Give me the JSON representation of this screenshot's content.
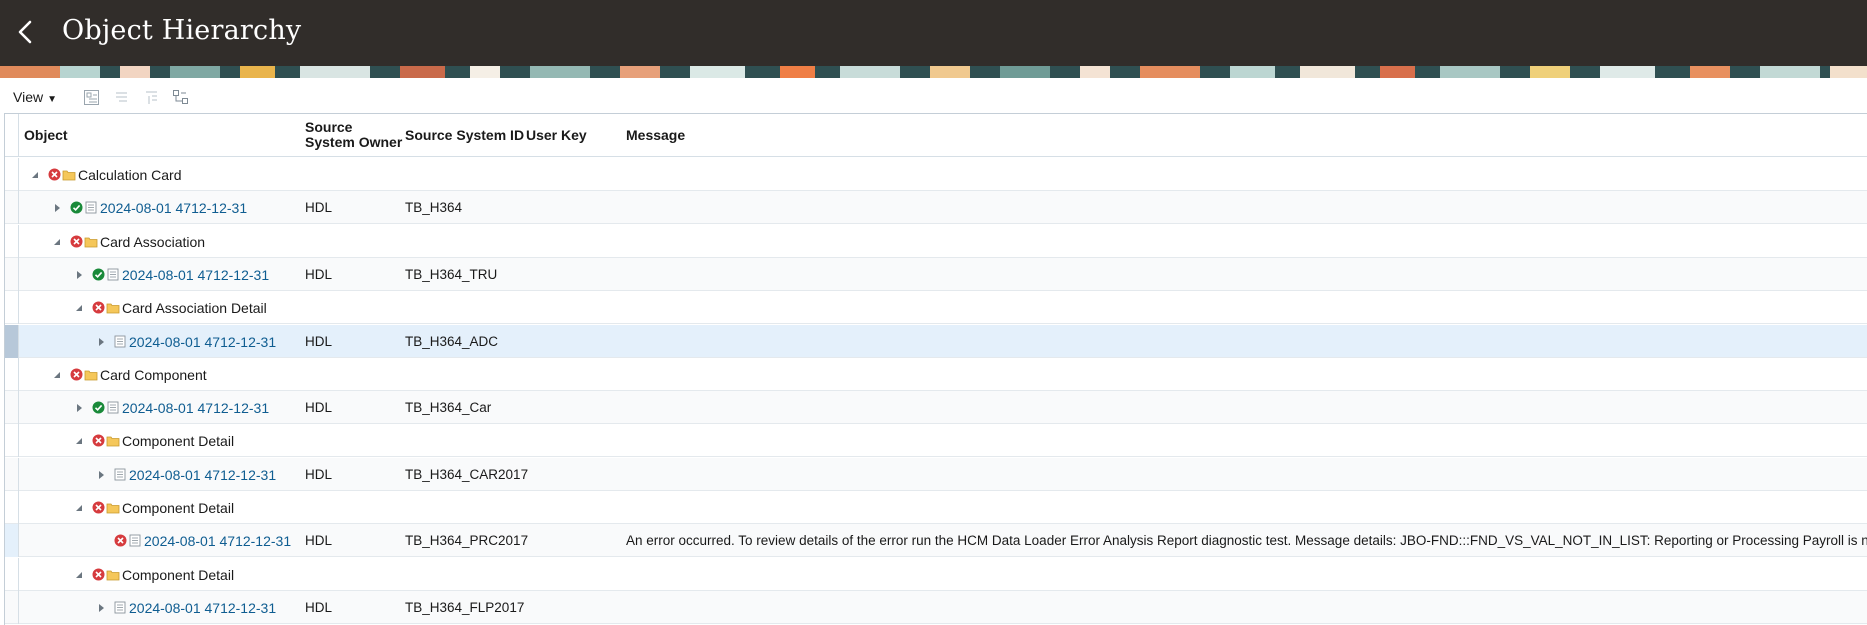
{
  "header": {
    "title": "Object Hierarchy"
  },
  "toolbar": {
    "view_label": "View",
    "tools": [
      "expand-all-icon",
      "collapse-icon",
      "collapse-all-icon",
      "hierarchy-icon"
    ]
  },
  "table": {
    "columns": {
      "object": "Object",
      "owner_line1": "Source",
      "owner_line2": "System Owner",
      "ssid": "Source System ID",
      "user_key": "User Key",
      "message": "Message"
    },
    "rows": [
      {
        "level": 0,
        "expanded": true,
        "type": "folder",
        "status": "error",
        "label": "Calculation Card",
        "owner": "",
        "ssid": "",
        "user_key": "",
        "message": ""
      },
      {
        "level": 1,
        "expanded": false,
        "type": "record",
        "status": "success",
        "label": "2024-08-01 4712-12-31",
        "owner": "HDL",
        "ssid": "TB_H364",
        "user_key": "",
        "message": ""
      },
      {
        "level": 1,
        "expanded": true,
        "type": "folder",
        "status": "error",
        "label": "Card Association",
        "owner": "",
        "ssid": "",
        "user_key": "",
        "message": ""
      },
      {
        "level": 2,
        "expanded": false,
        "type": "record",
        "status": "success",
        "label": "2024-08-01 4712-12-31",
        "owner": "HDL",
        "ssid": "TB_H364_TRU",
        "user_key": "",
        "message": ""
      },
      {
        "level": 2,
        "expanded": true,
        "type": "folder",
        "status": "error",
        "label": "Card Association Detail",
        "owner": "",
        "ssid": "",
        "user_key": "",
        "message": ""
      },
      {
        "level": 3,
        "expanded": false,
        "type": "record",
        "status": "none",
        "label": "2024-08-01 4712-12-31",
        "owner": "HDL",
        "ssid": "TB_H364_ADC",
        "user_key": "",
        "message": "",
        "selected": true
      },
      {
        "level": 1,
        "expanded": true,
        "type": "folder",
        "status": "error",
        "label": "Card Component",
        "owner": "",
        "ssid": "",
        "user_key": "",
        "message": ""
      },
      {
        "level": 2,
        "expanded": false,
        "type": "record",
        "status": "success",
        "label": "2024-08-01 4712-12-31",
        "owner": "HDL",
        "ssid": "TB_H364_Car",
        "user_key": "",
        "message": ""
      },
      {
        "level": 2,
        "expanded": true,
        "type": "folder",
        "status": "error",
        "label": "Component Detail",
        "owner": "",
        "ssid": "",
        "user_key": "",
        "message": ""
      },
      {
        "level": 3,
        "expanded": false,
        "type": "record",
        "status": "none",
        "label": "2024-08-01 4712-12-31",
        "owner": "HDL",
        "ssid": "TB_H364_CAR2017",
        "user_key": "",
        "message": ""
      },
      {
        "level": 2,
        "expanded": true,
        "type": "folder",
        "status": "error",
        "label": "Component Detail",
        "owner": "",
        "ssid": "",
        "user_key": "",
        "message": ""
      },
      {
        "level": 3,
        "expanded": null,
        "type": "record",
        "status": "error",
        "label": "2024-08-01 4712-12-31",
        "owner": "HDL",
        "ssid": "TB_H364_PRC2017",
        "user_key": "",
        "message": "An error occurred. To review details of the error run the HCM Data Loader Error Analysis Report diagnostic test. Message details: JBO-FND:::FND_VS_VAL_NOT_IN_LIST: Reporting or Processing Payroll is not in the list of",
        "marked": true
      },
      {
        "level": 2,
        "expanded": true,
        "type": "folder",
        "status": "error",
        "label": "Component Detail",
        "owner": "",
        "ssid": "",
        "user_key": "",
        "message": ""
      },
      {
        "level": 3,
        "expanded": false,
        "type": "record",
        "status": "none",
        "label": "2024-08-01 4712-12-31",
        "owner": "HDL",
        "ssid": "TB_H364_FLP2017",
        "user_key": "",
        "message": ""
      }
    ]
  },
  "colors": {
    "header_bg": "#312d2a",
    "link": "#0f5d91",
    "error": "#d63b3e",
    "success": "#1a8a3a",
    "folder": "#f5c75a",
    "selected_row": "#e4f0fb"
  }
}
